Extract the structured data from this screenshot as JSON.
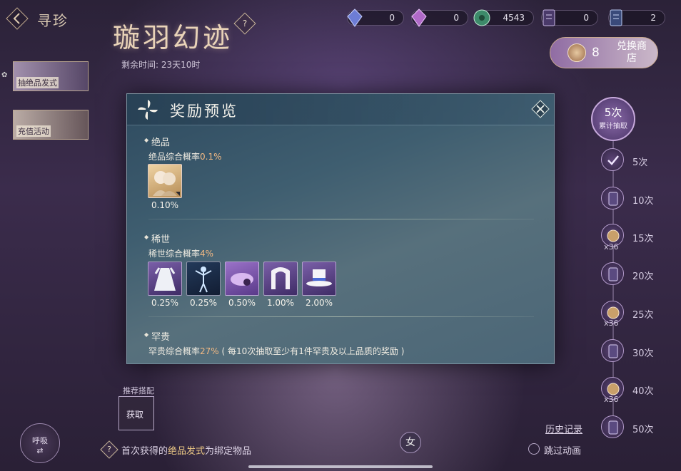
{
  "nav": {
    "title": "寻珍",
    "back_icon": "back-arrow-icon"
  },
  "event": {
    "title": "璇羽幻迹",
    "help_glyph": "?",
    "remaining_label": "剩余时间: 23天10时"
  },
  "currencies": [
    {
      "icon": "blue-crystal-icon",
      "value": "0"
    },
    {
      "icon": "pink-crystal-icon",
      "value": "0"
    },
    {
      "icon": "green-jade-icon",
      "value": "4543"
    },
    {
      "icon": "ticket-card-icon",
      "value": "0"
    },
    {
      "icon": "blue-ticket-card-icon",
      "value": "2"
    }
  ],
  "shop": {
    "count": "8",
    "label": "兑换商店"
  },
  "side_tabs": [
    {
      "label": "抽绝品发式"
    },
    {
      "label": "充值活动"
    }
  ],
  "milestones": {
    "head_count": "5次",
    "head_label": "累计抽取",
    "items": [
      {
        "label": "5次",
        "icon": "check-icon",
        "badge": ""
      },
      {
        "label": "10次",
        "icon": "ticket-card-icon",
        "badge": ""
      },
      {
        "label": "15次",
        "icon": "coin-icon",
        "badge": "x36"
      },
      {
        "label": "20次",
        "icon": "ticket-card-icon",
        "badge": ""
      },
      {
        "label": "25次",
        "icon": "coin-icon",
        "badge": "x36"
      },
      {
        "label": "30次",
        "icon": "ticket-card-icon",
        "badge": ""
      },
      {
        "label": "40次",
        "icon": "coin-icon",
        "badge": "x36"
      },
      {
        "label": "50次",
        "icon": "ticket-card-icon",
        "badge": ""
      }
    ]
  },
  "bottom": {
    "breath_title": "呼吸",
    "breath_glyph": "⇄",
    "recommend_label": "推荐搭配",
    "obtain_label": "获取",
    "notice_prefix": "首次获得的",
    "notice_highlight": "绝品发式",
    "notice_suffix": "为绑定物品",
    "notice_glyph": "?",
    "gender": "女",
    "history": "历史记录",
    "skip": "跳过动画"
  },
  "modal": {
    "title": "奖励预览",
    "sections": [
      {
        "name": "绝品",
        "rate_label": "绝品综合概率",
        "rate_value": "0.1%",
        "items": [
          {
            "icon": "twin-portrait-icon",
            "pct": "0.10%"
          }
        ]
      },
      {
        "name": "稀世",
        "rate_label": "稀世综合概率",
        "rate_value": "4%",
        "items": [
          {
            "icon": "white-dress-icon",
            "pct": "0.25%"
          },
          {
            "icon": "dancer-icon",
            "pct": "0.25%"
          },
          {
            "icon": "purple-scene-icon",
            "pct": "0.50%"
          },
          {
            "icon": "white-hair-icon",
            "pct": "1.00%"
          },
          {
            "icon": "white-hat-icon",
            "pct": "2.00%"
          }
        ]
      },
      {
        "name": "罕贵",
        "rate_label": "罕贵综合概率",
        "rate_value": "27%",
        "rate_note": "( 每10次抽取至少有1件罕贵及以上品质的奖励 )"
      }
    ]
  }
}
